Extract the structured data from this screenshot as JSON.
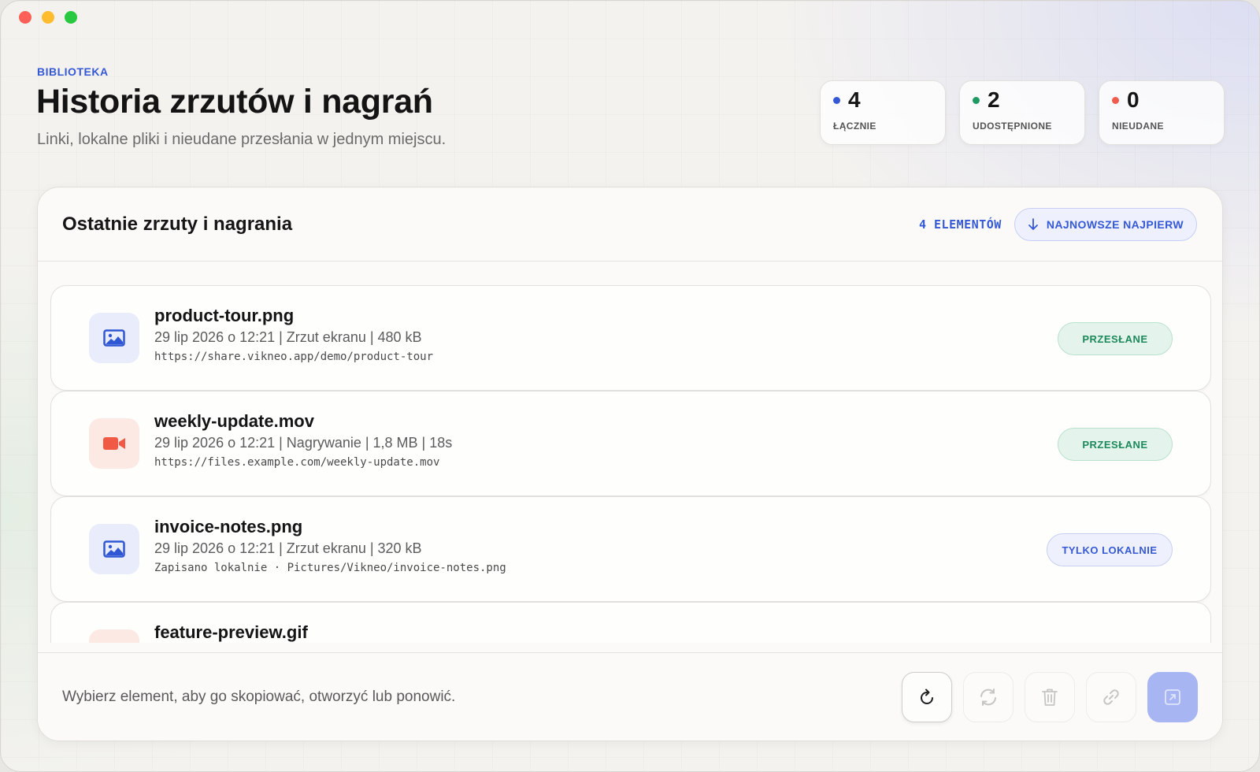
{
  "header": {
    "eyebrow": "BIBLIOTEKA",
    "title": "Historia zrzutów i nagrań",
    "subtitle": "Linki, lokalne pliki i nieudane przesłania w jednym miejscu."
  },
  "stats": [
    {
      "value": "4",
      "label": "ŁĄCZNIE",
      "color": "#3559d6"
    },
    {
      "value": "2",
      "label": "UDOSTĘPNIONE",
      "color": "#1f9a63"
    },
    {
      "value": "0",
      "label": "NIEUDANE",
      "color": "#ef5b4c"
    }
  ],
  "panel": {
    "title": "Ostatnie zrzuty i nagrania",
    "count": "4 ELEMENTÓW",
    "sort_label": "NAJNOWSZE NAJPIERW"
  },
  "items": [
    {
      "name": "product-tour.png",
      "meta": "29 lip 2026 o 12:21  |  Zrzut ekranu  |  480 kB",
      "path": "https://share.vikneo.app/demo/product-tour",
      "status": "PRZESŁANE",
      "type_icon": "image-icon"
    },
    {
      "name": "weekly-update.mov",
      "meta": "29 lip 2026 o 12:21  |  Nagrywanie  |  1,8 MB  |  18s",
      "path": "https://files.example.com/weekly-update.mov",
      "status": "PRZESŁANE",
      "type_icon": "video-camera-icon"
    },
    {
      "name": "invoice-notes.png",
      "meta": "29 lip 2026 o 12:21  |  Zrzut ekranu  |  320 kB",
      "path": "Zapisano lokalnie · Pictures/Vikneo/invoice-notes.png",
      "status": "TYLKO LOKALNIE",
      "type_icon": "image-icon"
    },
    {
      "name": "feature-preview.gif",
      "type_icon": "video-camera-icon"
    }
  ],
  "footer": {
    "hint": "Wybierz element, aby go skopiować, otworzyć lub ponowić.",
    "actions": [
      "refresh-icon",
      "retry-icon",
      "trash-icon",
      "link-icon",
      "open-external-icon"
    ]
  },
  "colors": {
    "accent": "#3559d6",
    "success": "#1d8a5c",
    "danger": "#ef5b4c"
  }
}
